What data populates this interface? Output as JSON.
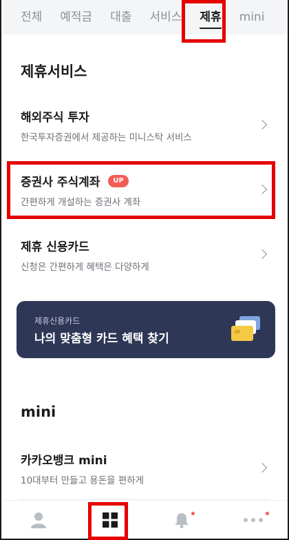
{
  "tabs": [
    {
      "label": "전체"
    },
    {
      "label": "예적금"
    },
    {
      "label": "대출"
    },
    {
      "label": "서비스"
    },
    {
      "label": "제휴"
    },
    {
      "label": "mini"
    }
  ],
  "active_tab": "제휴",
  "section_partner": {
    "title": "제휴서비스",
    "items": [
      {
        "title": "해외주식 투자",
        "subtitle": "한국투자증권에서 제공하는 미니스탁 서비스"
      },
      {
        "title": "증권사 주식계좌",
        "badge": "UP",
        "subtitle": "간편하게 개설하는 증권사 계좌"
      },
      {
        "title": "제휴 신용카드",
        "subtitle": "신청은 간편하게 혜택은 다양하게"
      }
    ]
  },
  "banner": {
    "caption": "제휴신용카드",
    "title": "나의 맞춤형 카드 혜택 찾기"
  },
  "section_mini": {
    "title": "mini",
    "items": [
      {
        "title": "카카오뱅크 mini",
        "subtitle": "10대부터 만들고 용돈을 편하게"
      }
    ]
  },
  "bottom_nav": [
    {
      "icon": "person-icon",
      "has_dot": false
    },
    {
      "icon": "grid-icon",
      "has_dot": false
    },
    {
      "icon": "bell-icon",
      "has_dot": true
    },
    {
      "icon": "more-icon",
      "has_dot": true
    }
  ],
  "colors": {
    "accent_red": "#e60000",
    "badge": "#f25c54",
    "banner_bg": "#2f3756"
  }
}
